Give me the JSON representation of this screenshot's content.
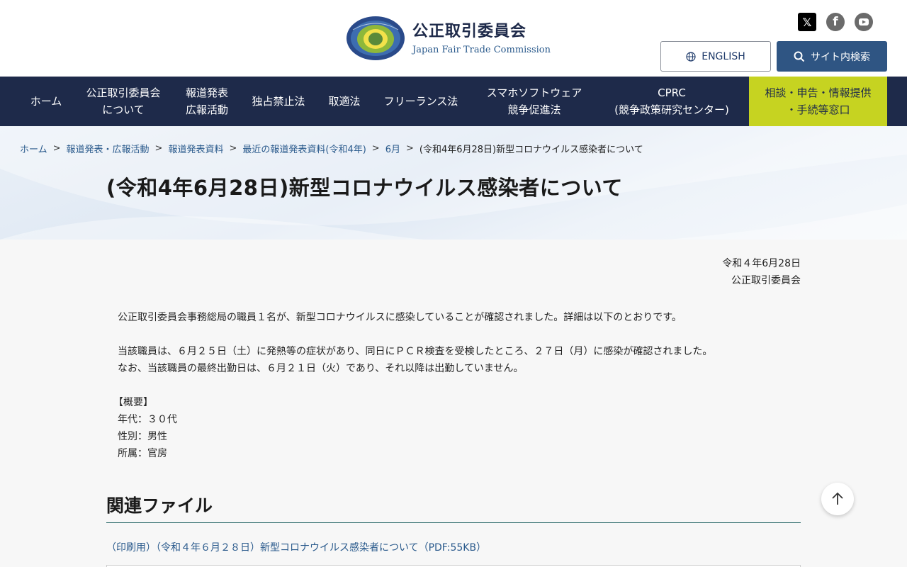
{
  "header": {
    "logo_jp": "公正取引委員会",
    "logo_en": "Japan Fair Trade Commission",
    "english_label": "ENGLISH",
    "search_label": "サイト内検索",
    "social": [
      "x-icon",
      "facebook-icon",
      "youtube-icon"
    ]
  },
  "nav": {
    "items": [
      {
        "line1": "ホーム",
        "line2": ""
      },
      {
        "line1": "公正取引委員会",
        "line2": "について"
      },
      {
        "line1": "報道発表",
        "line2": "広報活動"
      },
      {
        "line1": "独占禁止法",
        "line2": ""
      },
      {
        "line1": "取適法",
        "line2": ""
      },
      {
        "line1": "フリーランス法",
        "line2": ""
      },
      {
        "line1": "スマホソフトウェア",
        "line2": "競争促進法"
      },
      {
        "line1": "CPRC",
        "line2": "(競争政策研究センター)"
      }
    ],
    "consult": {
      "line1": "相談・申告・情報提供",
      "line2": "・手続等窓口"
    }
  },
  "breadcrumb": {
    "items": [
      "ホーム",
      "報道発表・広報活動",
      "報道発表資料",
      "最近の報道発表資料(令和4年)",
      "6月"
    ],
    "current": "(令和4年6月28日)新型コロナウイルス感染者について",
    "separator": ">"
  },
  "page_title": "(令和4年6月28日)新型コロナウイルス感染者について",
  "main": {
    "date": "令和４年6月28日",
    "issuer": "公正取引委員会",
    "para1": "公正取引委員会事務総局の職員１名が、新型コロナウイルスに感染していることが確認されました。詳細は以下のとおりです。",
    "para2a": "当該職員は、６月２５日（土）に発熱等の症状があり、同日にＰＣＲ検査を受検したところ、２７日（月）に感染が確認されました。",
    "para2b": "なお、当該職員の最終出勤日は、６月２１日（火）であり、それ以降は出勤していません。",
    "summary_heading": "【概要】",
    "age": "年代：３０代",
    "gender": "性別：男性",
    "dept": "所属：官房"
  },
  "related": {
    "heading": "関連ファイル",
    "file_link": "（印刷用）（令和４年６月２８日）新型コロナウイルス感染者について（PDF:55KB）"
  },
  "colors": {
    "nav_bg": "#1e2a4a",
    "accent": "#c6d321",
    "link": "#2a5a8c",
    "search_btn": "#2f5583"
  }
}
